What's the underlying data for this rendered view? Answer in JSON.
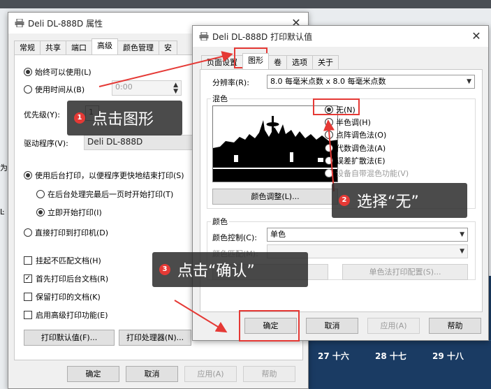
{
  "colors": {
    "accent_red": "#e53935",
    "callout_bg": "#282828",
    "calendar_bg": "#1a3b63"
  },
  "background": {
    "calendar_days": [
      "27 十六",
      "28 十七",
      "29 十八"
    ],
    "desktop_labels": [
      "为",
      "Ŀ"
    ]
  },
  "props_window": {
    "title": "Deli DL-888D 属性",
    "tabs": [
      "常规",
      "共享",
      "端口",
      "高级",
      "颜色管理",
      "安"
    ],
    "selected_tab": "高级",
    "avail_always": "始终可以使用(L)",
    "avail_from": "使用时间从(B)",
    "time_value": "0:00",
    "priority_label": "优先级(Y):",
    "priority_value": "1",
    "driver_label": "驱动程序(V):",
    "driver_value": "Deli DL-888D",
    "spool": "使用后台打印，以便程序更快地结束打印(S)",
    "spool_after_last": "在后台处理完最后一页时开始打印(T)",
    "spool_immediately": "立即开始打印(I)",
    "direct": "直接打印到打印机(D)",
    "hold_mismatched": "挂起不匹配文档(H)",
    "print_spooled_first": "首先打印后台文档(R)",
    "keep_printed": "保留打印的文档(K)",
    "advanced_features": "启用高级打印功能(E)",
    "btn_defaults": "打印默认值(F)...",
    "btn_processor": "打印处理器(N)...",
    "btn_ok": "确定",
    "btn_cancel": "取消",
    "btn_apply": "应用(A)",
    "btn_help": "帮助"
  },
  "defaults_dialog": {
    "title": "Deli DL-888D 打印默认值",
    "tabs": [
      "页面设置",
      "图形",
      "卷",
      "选项",
      "关于"
    ],
    "selected_tab": "图形",
    "resolution_label": "分辨率(R):",
    "resolution_value": "8.0 每毫米点数 x 8.0 每毫米点数",
    "dither_group": "混色",
    "dither_options": [
      "无(N)",
      "半色调(H)",
      "点阵调色法(O)",
      "代数调色法(A)",
      "误差扩散法(E)",
      "设备自带混色功能(V)"
    ],
    "dither_selected": "无(N)",
    "color_adjust_btn": "颜色调整(L)...",
    "color_group": "颜色",
    "color_control_label": "颜色控制(C):",
    "color_control_value": "单色",
    "color_match_label": "颜色匹配(M):",
    "color_profile_btn": "单色法打印配置(S)...",
    "btn_ok": "确定",
    "btn_cancel": "取消",
    "btn_apply": "应用(A)",
    "btn_help": "帮助"
  },
  "annotations": [
    {
      "num": "1",
      "text": "点击图形"
    },
    {
      "num": "2",
      "text": "选择“无”"
    },
    {
      "num": "3",
      "text": "点击“确认”"
    }
  ]
}
